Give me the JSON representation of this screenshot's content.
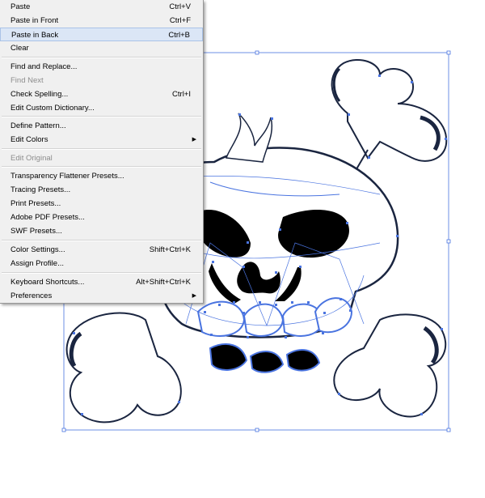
{
  "menu": {
    "items": [
      {
        "label": "Paste",
        "shortcut": "Ctrl+V"
      },
      {
        "label": "Paste in Front",
        "shortcut": "Ctrl+F"
      },
      {
        "label": "Paste in Back",
        "shortcut": "Ctrl+B"
      },
      {
        "label": "Clear",
        "shortcut": ""
      },
      {
        "label": "Find and Replace...",
        "shortcut": ""
      },
      {
        "label": "Find Next",
        "shortcut": ""
      },
      {
        "label": "Check Spelling...",
        "shortcut": "Ctrl+I"
      },
      {
        "label": "Edit Custom Dictionary...",
        "shortcut": ""
      },
      {
        "label": "Define Pattern...",
        "shortcut": ""
      },
      {
        "label": "Edit Colors",
        "shortcut": ""
      },
      {
        "label": "Edit Original",
        "shortcut": ""
      },
      {
        "label": "Transparency Flattener Presets...",
        "shortcut": ""
      },
      {
        "label": "Tracing Presets...",
        "shortcut": ""
      },
      {
        "label": "Print Presets...",
        "shortcut": ""
      },
      {
        "label": "Adobe PDF Presets...",
        "shortcut": ""
      },
      {
        "label": "SWF Presets...",
        "shortcut": ""
      },
      {
        "label": "Color Settings...",
        "shortcut": "Shift+Ctrl+K"
      },
      {
        "label": "Assign Profile...",
        "shortcut": ""
      },
      {
        "label": "Keyboard Shortcuts...",
        "shortcut": "Alt+Shift+Ctrl+K"
      },
      {
        "label": "Preferences",
        "shortcut": ""
      }
    ],
    "highlighted": "Paste in Back",
    "disabled": [
      "Find Next",
      "Edit Original"
    ],
    "submenu_arrow": "▶"
  },
  "artwork": {
    "subject": "skull-and-crossbones",
    "selection_color": "#4a74e0",
    "stroke_color": "#1a2540"
  }
}
